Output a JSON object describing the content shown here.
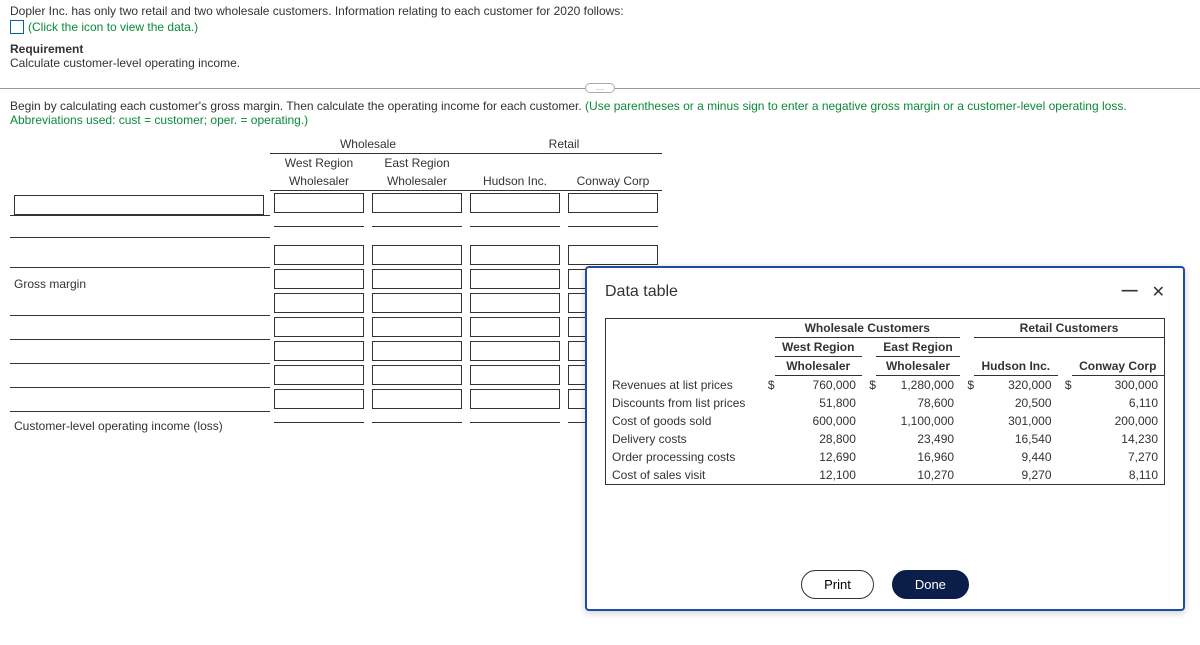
{
  "header": {
    "intro": "Dopler Inc. has only two retail and two wholesale customers. Information relating to each customer for 2020 follows:",
    "icon_hint": "(Click the icon to view the data.)",
    "requirement_title": "Requirement",
    "requirement_desc": "Calculate customer-level operating income."
  },
  "instruction": {
    "lead": "Begin by calculating each customer's gross margin. Then calculate the operating income for each customer. ",
    "hint": "(Use parentheses or a minus sign to enter a negative gross margin or a customer-level operating loss. Abbreviations used: cust = customer; oper. = operating.)"
  },
  "worksheet": {
    "groups": {
      "wholesale": "Wholesale",
      "retail": "Retail"
    },
    "columns": {
      "west": {
        "l1": "West Region",
        "l2": "Wholesaler"
      },
      "east": {
        "l1": "East Region",
        "l2": "Wholesaler"
      },
      "hudson": {
        "l1": "",
        "l2": "Hudson Inc."
      },
      "conway": {
        "l1": "",
        "l2": "Conway Corp"
      }
    },
    "rows": {
      "gross_margin": "Gross margin",
      "op_income": "Customer-level operating income (loss)"
    }
  },
  "modal": {
    "title": "Data table",
    "print": "Print",
    "done": "Done",
    "group_wholesale": "Wholesale Customers",
    "group_retail": "Retail Customers",
    "cols": {
      "west": {
        "l1": "West Region",
        "l2": "Wholesaler"
      },
      "east": {
        "l1": "East Region",
        "l2": "Wholesaler"
      },
      "hudson": "Hudson Inc.",
      "conway": "Conway Corp"
    },
    "rows": [
      {
        "label": "Revenues at list prices",
        "dollar": true,
        "west": "760,000",
        "east": "1,280,000",
        "hudson": "320,000",
        "conway": "300,000"
      },
      {
        "label": "Discounts from list prices",
        "dollar": false,
        "west": "51,800",
        "east": "78,600",
        "hudson": "20,500",
        "conway": "6,110"
      },
      {
        "label": "Cost of goods sold",
        "dollar": false,
        "west": "600,000",
        "east": "1,100,000",
        "hudson": "301,000",
        "conway": "200,000"
      },
      {
        "label": "Delivery costs",
        "dollar": false,
        "west": "28,800",
        "east": "23,490",
        "hudson": "16,540",
        "conway": "14,230"
      },
      {
        "label": "Order processing costs",
        "dollar": false,
        "west": "12,690",
        "east": "16,960",
        "hudson": "9,440",
        "conway": "7,270"
      },
      {
        "label": "Cost of sales visit",
        "dollar": false,
        "west": "12,100",
        "east": "10,270",
        "hudson": "9,270",
        "conway": "8,110"
      }
    ]
  },
  "chart_data": {
    "type": "table",
    "title": "Data table",
    "columns": [
      "West Region Wholesaler",
      "East Region Wholesaler",
      "Hudson Inc.",
      "Conway Corp"
    ],
    "rows": [
      {
        "label": "Revenues at list prices",
        "values": [
          760000,
          1280000,
          320000,
          300000
        ]
      },
      {
        "label": "Discounts from list prices",
        "values": [
          51800,
          78600,
          20500,
          6110
        ]
      },
      {
        "label": "Cost of goods sold",
        "values": [
          600000,
          1100000,
          301000,
          200000
        ]
      },
      {
        "label": "Delivery costs",
        "values": [
          28800,
          23490,
          16540,
          14230
        ]
      },
      {
        "label": "Order processing costs",
        "values": [
          12690,
          16960,
          9440,
          7270
        ]
      },
      {
        "label": "Cost of sales visit",
        "values": [
          12100,
          10270,
          9270,
          8110
        ]
      }
    ]
  }
}
